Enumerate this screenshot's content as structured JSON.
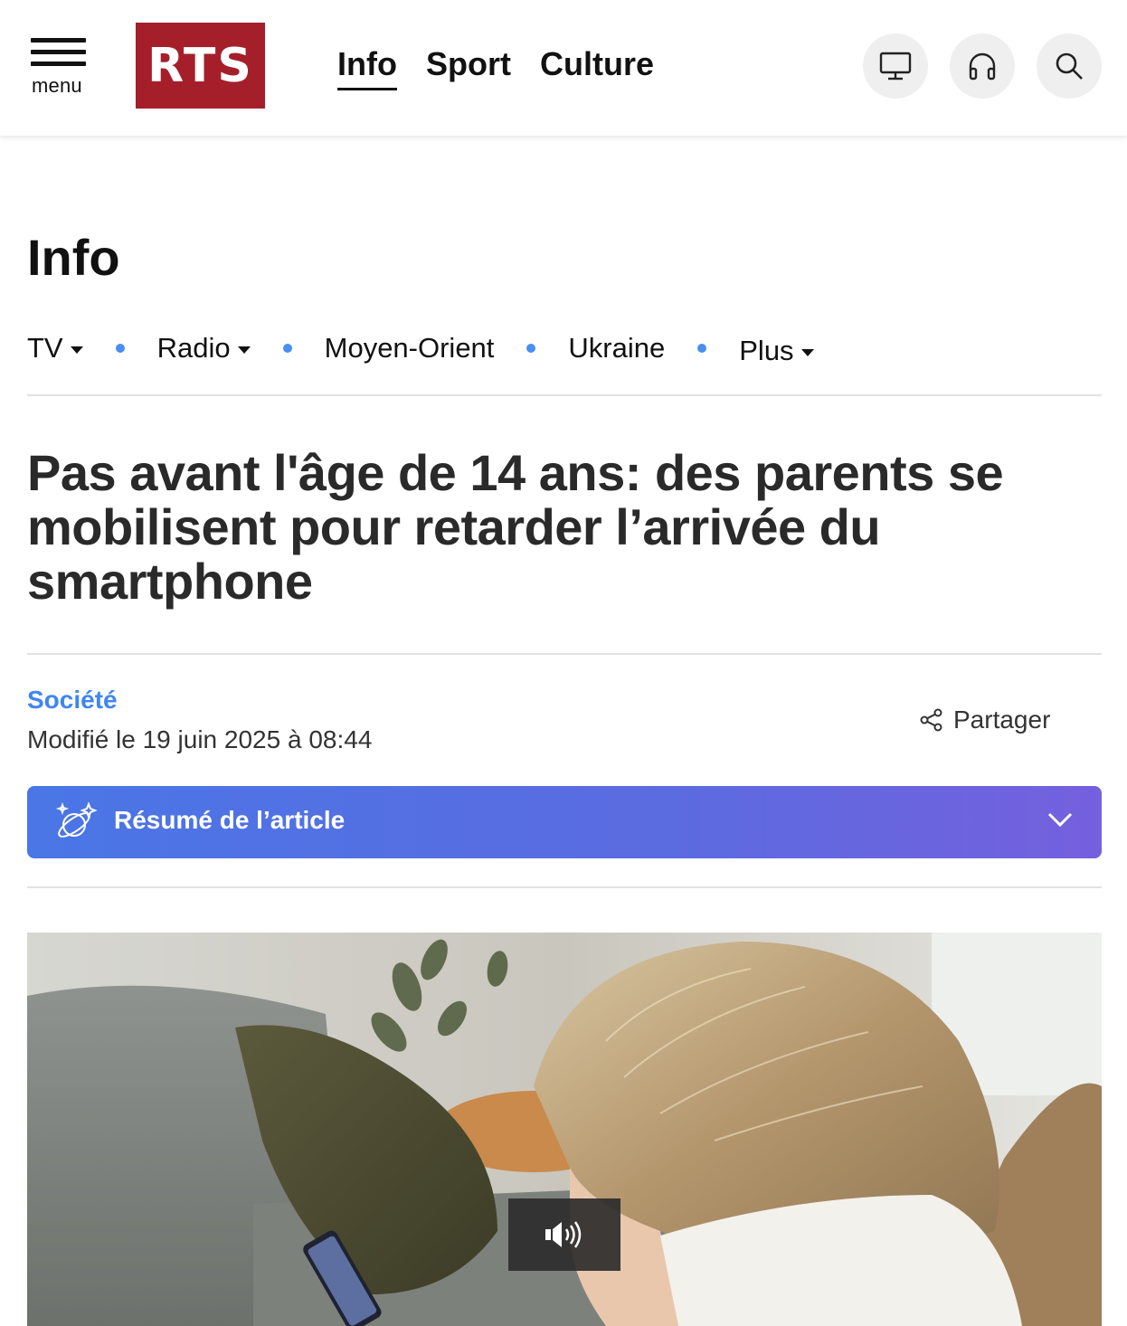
{
  "header": {
    "menu_label": "menu",
    "logo_text": "RTS",
    "nav": [
      {
        "label": "Info",
        "active": true
      },
      {
        "label": "Sport",
        "active": false
      },
      {
        "label": "Culture",
        "active": false
      }
    ],
    "icons": [
      "tv-icon",
      "headphones-icon",
      "search-icon"
    ]
  },
  "section": {
    "title": "Info",
    "subnav": [
      {
        "label": "TV",
        "dropdown": true
      },
      {
        "label": "Radio",
        "dropdown": true
      },
      {
        "label": "Moyen-Orient",
        "dropdown": false
      },
      {
        "label": "Ukraine",
        "dropdown": false
      },
      {
        "label": "Plus",
        "dropdown": true
      }
    ]
  },
  "article": {
    "headline": "Pas avant l'âge de 14 ans: des parents se mobilisent pour retarder l’arrivée du smartphone",
    "category": "Société",
    "modified": "Modifié le 19 juin 2025 à 08:44",
    "share_label": "Partager",
    "summary_label": "Résumé de l’article"
  },
  "colors": {
    "brand_red": "#a51f2b",
    "accent_blue": "#3f86f0",
    "summary_gradient_start": "#4a76e6",
    "summary_gradient_end": "#7560de"
  }
}
